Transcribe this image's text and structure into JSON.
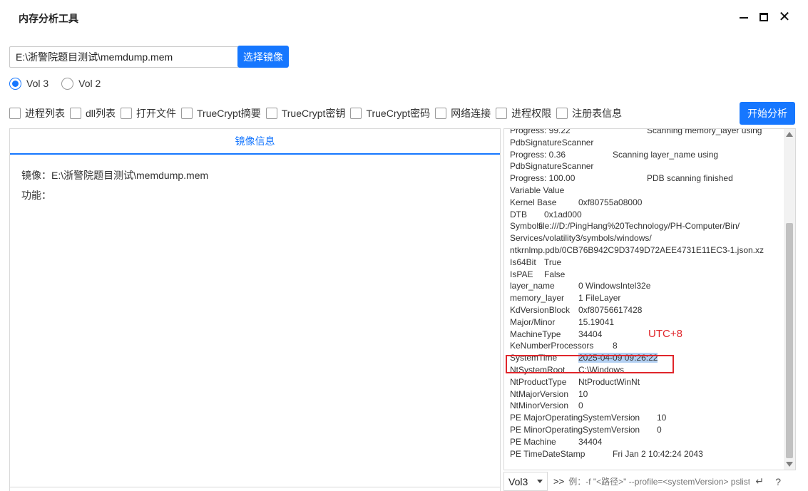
{
  "window": {
    "title": "内存分析工具",
    "minimize_icon": "minimize-icon",
    "maximize_icon": "maximize-icon",
    "close_icon": "close-icon",
    "close_glyph": "✕"
  },
  "image_selector": {
    "path_value": "E:\\浙警院题目测试\\memdump.mem",
    "select_button": "选择镜像"
  },
  "volatility_versions": [
    {
      "label": "Vol 3",
      "checked": true
    },
    {
      "label": "Vol 2",
      "checked": false
    }
  ],
  "plugins": [
    {
      "label": "进程列表",
      "checked": false
    },
    {
      "label": "dll列表",
      "checked": false
    },
    {
      "label": "打开文件",
      "checked": false
    },
    {
      "label": "TrueCrypt摘要",
      "checked": false
    },
    {
      "label": "TrueCrypt密钥",
      "checked": false
    },
    {
      "label": "TrueCrypt密码",
      "checked": false
    },
    {
      "label": "网络连接",
      "checked": false
    },
    {
      "label": "进程权限",
      "checked": false
    },
    {
      "label": "注册表信息",
      "checked": false
    }
  ],
  "start_button": "开始分析",
  "image_info": {
    "tab_title": "镜像信息",
    "image_line": "镜像：E:\\浙警院题目测试\\memdump.mem",
    "function_line": "功能："
  },
  "log": {
    "lines": [
      [
        "Progress:   99.22",
        "Scanning memory_layer using"
      ],
      [
        "PdbSignatureScanner",
        ""
      ],
      [
        "Progress:    0.36",
        "Scanning layer_name using"
      ],
      [
        "PdbSignatureScanner",
        ""
      ],
      [
        "Progress:  100.00",
        "PDB scanning finished"
      ],
      [
        "Variable Value",
        ""
      ],
      [
        "Kernel Base",
        "0xf80755a08000"
      ],
      [
        "DTB",
        "0x1ad000"
      ],
      [
        "Symbols",
        "file:///D:/PingHang%20Technology/PH-Computer/Bin/"
      ],
      [
        "Services/volatility3/symbols/windows/",
        ""
      ],
      [
        "ntkrnlmp.pdb/0CB76B942C9D3749D72AEE4731E11EC3-1.json.xz",
        ""
      ],
      [
        "Is64Bit",
        "True"
      ],
      [
        "IsPAE",
        "False"
      ],
      [
        "layer_name",
        "0 WindowsIntel32e"
      ],
      [
        "memory_layer",
        "1 FileLayer"
      ],
      [
        "KdVersionBlock",
        "0xf80756617428"
      ],
      [
        "Major/Minor",
        "15.19041"
      ],
      [
        "MachineType",
        "34404"
      ],
      [
        "KeNumberProcessors",
        "8"
      ],
      [
        "SystemTime",
        "2025-04-09 09:26:22"
      ],
      [
        "NtSystemRoot",
        "C:\\Windows"
      ],
      [
        "NtProductType",
        "NtProductWinNt"
      ],
      [
        "NtMajorVersion",
        "10"
      ],
      [
        "NtMinorVersion",
        "0"
      ],
      [
        "PE MajorOperatingSystemVersion",
        "10"
      ],
      [
        "PE MinorOperatingSystemVersion",
        "0"
      ],
      [
        "PE Machine",
        "34404"
      ],
      [
        "PE TimeDateStamp",
        "Fri Jan  2 10:42:24 2043"
      ]
    ],
    "selected_line": 19,
    "annotation": "UTC+8",
    "highlight_color": "#e0262b"
  },
  "command_bar": {
    "version_selected": "Vol3",
    "prompt": ">>",
    "placeholder": "例：-f \"<路径>\" --profile=<systemVersion> pslist",
    "enter_glyph": "↵",
    "help_glyph": "?"
  },
  "colors": {
    "accent": "#1677ff",
    "selection": "#b3d0f2"
  }
}
